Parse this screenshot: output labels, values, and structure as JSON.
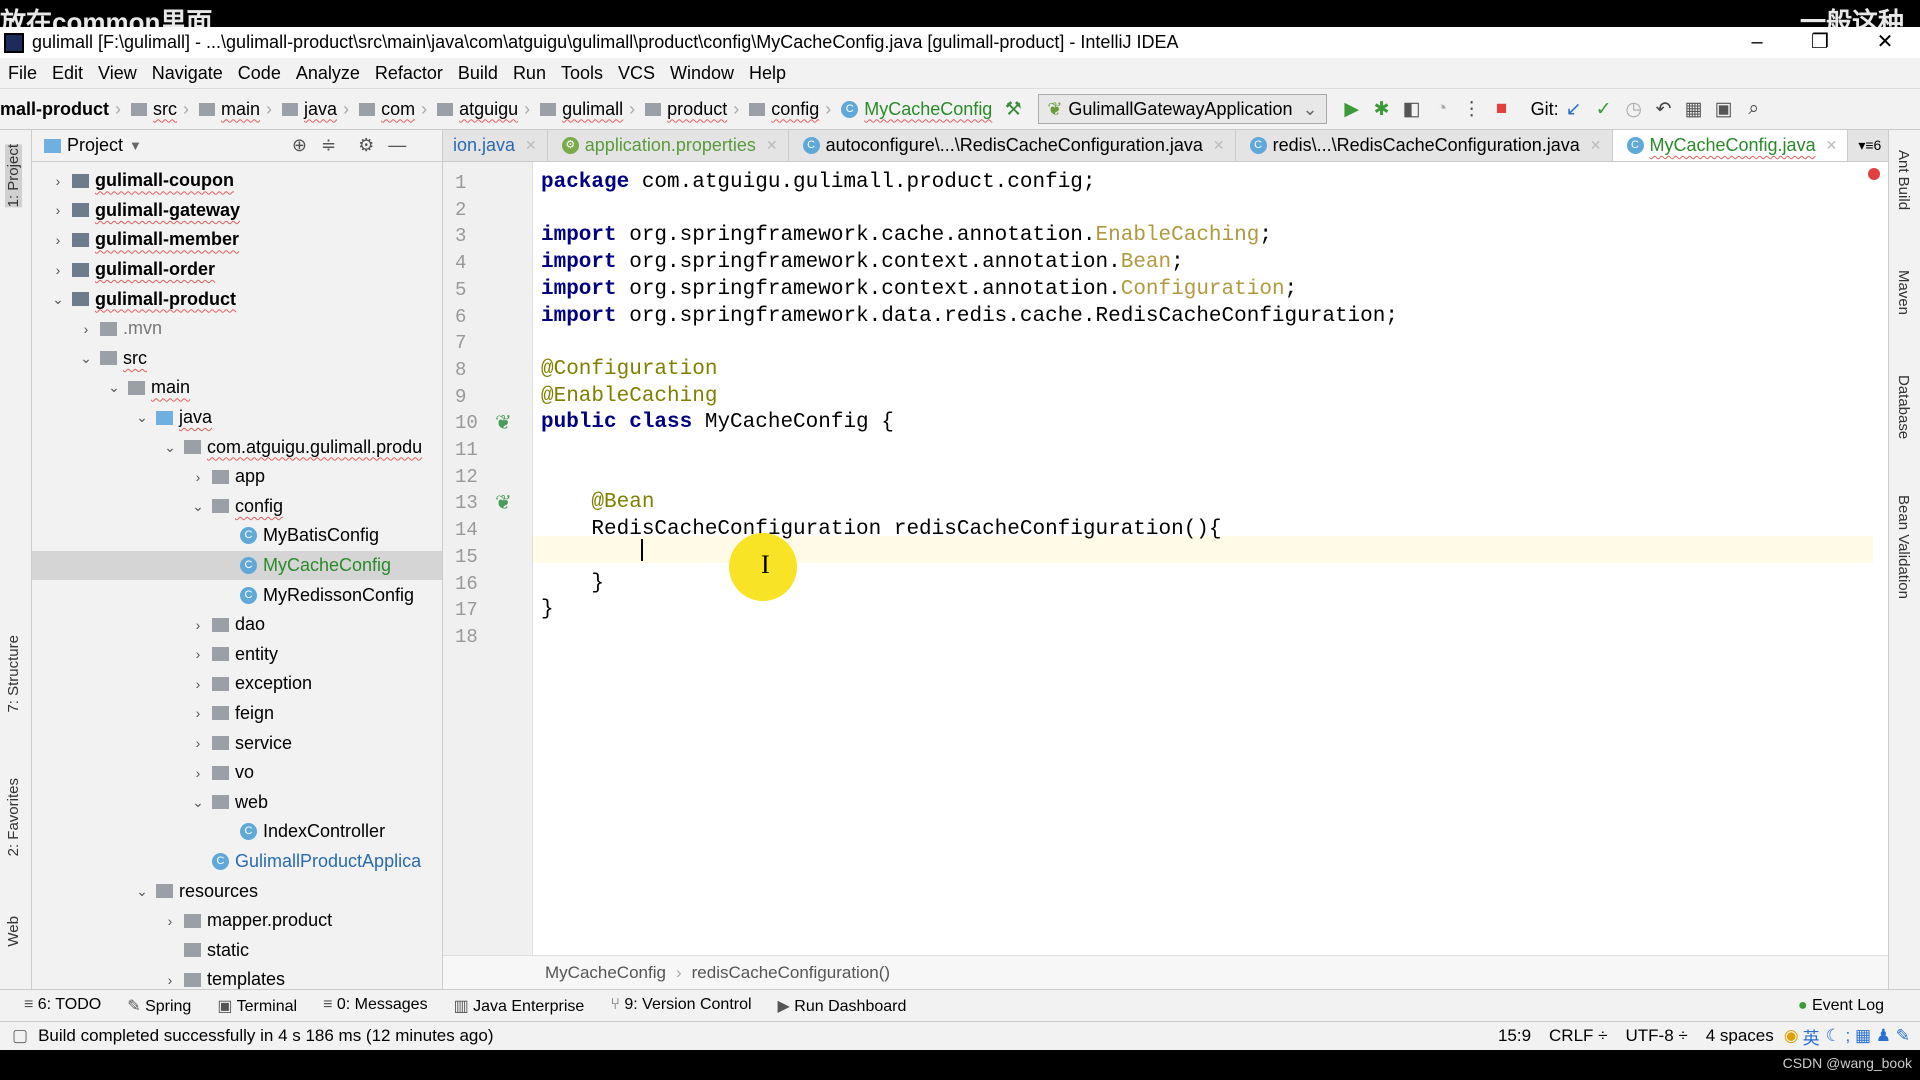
{
  "overlay": {
    "caption_left": "放在common里面",
    "caption_right": "一般这种",
    "watermark": "CSDN @wang_book"
  },
  "window": {
    "title": "gulimall [F:\\gulimall] - ...\\gulimall-product\\src\\main\\java\\com\\atguigu\\gulimall\\product\\config\\MyCacheConfig.java [gulimall-product] - IntelliJ IDEA",
    "minimize": "–",
    "restore": "❐",
    "close": "✕"
  },
  "menu": [
    "File",
    "Edit",
    "View",
    "Navigate",
    "Code",
    "Analyze",
    "Refactor",
    "Build",
    "Run",
    "Tools",
    "VCS",
    "Window",
    "Help"
  ],
  "nav": {
    "crumbs": [
      "mall-product",
      "src",
      "main",
      "java",
      "com",
      "atguigu",
      "gulimall",
      "product",
      "config",
      "MyCacheConfig"
    ],
    "run_config": "GulimallGatewayApplication",
    "git_label": "Git:"
  },
  "left_strip": [
    "1: Project",
    "7: Structure",
    "2: Favorites",
    "Web"
  ],
  "right_strip": [
    "Ant Build",
    "Maven",
    "Database",
    "Bean Validation"
  ],
  "project": {
    "title": "Project",
    "items": [
      {
        "label": "gulimall-coupon",
        "level": 0,
        "arrow": "›",
        "type": "module",
        "bold": true
      },
      {
        "label": "gulimall-gateway",
        "level": 0,
        "arrow": "›",
        "type": "module",
        "bold": true
      },
      {
        "label": "gulimall-member",
        "level": 0,
        "arrow": "›",
        "type": "module",
        "bold": true
      },
      {
        "label": "gulimall-order",
        "level": 0,
        "arrow": "›",
        "type": "module",
        "bold": true
      },
      {
        "label": "gulimall-product",
        "level": 0,
        "arrow": "⌄",
        "type": "module",
        "bold": true
      },
      {
        "label": ".mvn",
        "level": 1,
        "arrow": "›",
        "type": "folder",
        "grey": true
      },
      {
        "label": "src",
        "level": 1,
        "arrow": "⌄",
        "type": "folder"
      },
      {
        "label": "main",
        "level": 2,
        "arrow": "⌄",
        "type": "folder"
      },
      {
        "label": "java",
        "level": 3,
        "arrow": "⌄",
        "type": "blue"
      },
      {
        "label": "com.atguigu.gulimall.produ",
        "level": 4,
        "arrow": "⌄",
        "type": "folder"
      },
      {
        "label": "app",
        "level": 5,
        "arrow": "›",
        "type": "folder"
      },
      {
        "label": "config",
        "level": 5,
        "arrow": "⌄",
        "type": "folder"
      },
      {
        "label": "MyBatisConfig",
        "level": 6,
        "arrow": "",
        "type": "class"
      },
      {
        "label": "MyCacheConfig",
        "level": 6,
        "arrow": "",
        "type": "class",
        "selected": true
      },
      {
        "label": "MyRedissonConfig",
        "level": 6,
        "arrow": "",
        "type": "class"
      },
      {
        "label": "dao",
        "level": 5,
        "arrow": "›",
        "type": "folder"
      },
      {
        "label": "entity",
        "level": 5,
        "arrow": "›",
        "type": "folder"
      },
      {
        "label": "exception",
        "level": 5,
        "arrow": "›",
        "type": "folder"
      },
      {
        "label": "feign",
        "level": 5,
        "arrow": "›",
        "type": "folder"
      },
      {
        "label": "service",
        "level": 5,
        "arrow": "›",
        "type": "folder"
      },
      {
        "label": "vo",
        "level": 5,
        "arrow": "›",
        "type": "folder"
      },
      {
        "label": "web",
        "level": 5,
        "arrow": "⌄",
        "type": "folder"
      },
      {
        "label": "IndexController",
        "level": 6,
        "arrow": "",
        "type": "class"
      },
      {
        "label": "GulimallProductApplica",
        "level": 5,
        "arrow": "",
        "type": "class",
        "blue": true
      },
      {
        "label": "resources",
        "level": 3,
        "arrow": "⌄",
        "type": "folder"
      },
      {
        "label": "mapper.product",
        "level": 4,
        "arrow": "›",
        "type": "folder"
      },
      {
        "label": "static",
        "level": 4,
        "arrow": "",
        "type": "folder"
      },
      {
        "label": "templates",
        "level": 4,
        "arrow": "›",
        "type": "folder"
      }
    ]
  },
  "tabs": [
    {
      "label": "ion.java",
      "active": false
    },
    {
      "label": "application.properties",
      "active": false,
      "green": true
    },
    {
      "label": "autoconfigure\\...\\RedisCacheConfiguration.java",
      "active": false
    },
    {
      "label": "redis\\...\\RedisCacheConfiguration.java",
      "active": false
    },
    {
      "label": "MyCacheConfig.java",
      "active": true
    }
  ],
  "tabs_overflow": "▾≡6",
  "editor": {
    "lines": [
      [
        [
          "package",
          "kw"
        ],
        [
          " com.atguigu.gulimall.product.config;",
          ""
        ]
      ],
      [],
      [
        [
          "import",
          "kw"
        ],
        [
          " org.springframework.cache.annotation.",
          ""
        ],
        [
          "EnableCaching",
          "un"
        ],
        [
          ";",
          ""
        ]
      ],
      [
        [
          "import",
          "kw"
        ],
        [
          " org.springframework.context.annotation.",
          ""
        ],
        [
          "Bean",
          "un"
        ],
        [
          ";",
          ""
        ]
      ],
      [
        [
          "import",
          "kw"
        ],
        [
          " org.springframework.context.annotation.",
          ""
        ],
        [
          "Configuration",
          "un"
        ],
        [
          ";",
          ""
        ]
      ],
      [
        [
          "import",
          "kw"
        ],
        [
          " org.springframework.data.redis.cache.RedisCacheConfiguration;",
          ""
        ]
      ],
      [],
      [
        [
          "@Configuration",
          "an"
        ]
      ],
      [
        [
          "@EnableCaching",
          "an"
        ]
      ],
      [
        [
          "public class",
          "kw"
        ],
        [
          " MyCacheConfig {",
          ""
        ]
      ],
      [],
      [],
      [
        [
          "    @Bean",
          "an"
        ]
      ],
      [
        [
          "    RedisCacheConfiguration redisCacheConfiguration(){",
          ""
        ]
      ],
      [
        [
          "        ",
          ""
        ]
      ],
      [
        [
          "    }",
          ""
        ]
      ],
      [
        [
          "}",
          ""
        ]
      ],
      []
    ],
    "cursor": "15:9"
  },
  "breadcrumb": [
    "MyCacheConfig",
    "redisCacheConfiguration()"
  ],
  "toolwindows": [
    "6: TODO",
    "Spring",
    "Terminal",
    "0: Messages",
    "Java Enterprise",
    "9: Version Control",
    "Run Dashboard"
  ],
  "event_log": "Event Log",
  "status": {
    "message": "Build completed successfully in 4 s 186 ms (12 minutes ago)",
    "position": "15:9",
    "line_sep": "CRLF ÷",
    "encoding": "UTF-8 ÷",
    "indent": "4 spaces",
    "ime": "英"
  }
}
